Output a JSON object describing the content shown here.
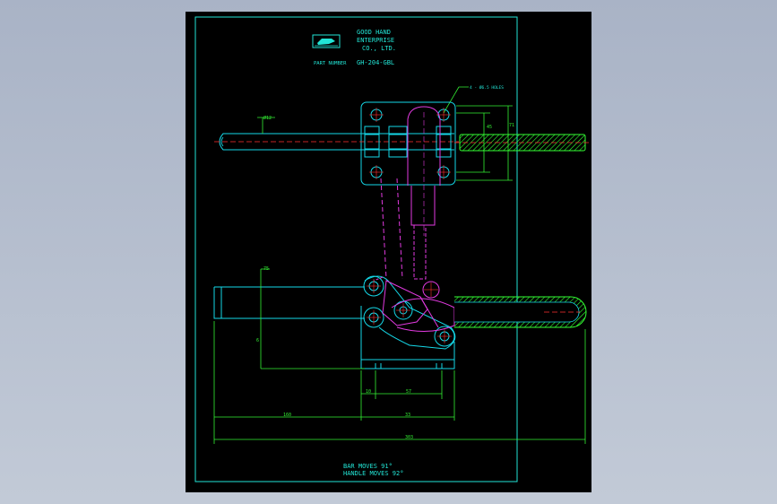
{
  "colors": {
    "background": "#a9b3c6",
    "sheet": "#000000",
    "border": "#22e5d6",
    "outline": "#15d8e8",
    "linkage": "#e23ae0",
    "centerline": "#ff3030",
    "handle_grip": "#33ff33",
    "dimension": "#33f033",
    "text": "#22e5d6"
  },
  "title_block": {
    "logo_icon": "good-hand-logo",
    "company_line1": "GOOD HAND",
    "company_line2": "ENTERPRISE",
    "company_line3": "CO., LTD.",
    "part_number_label": "PART NUMBER",
    "part_number": "GH-204-GBL"
  },
  "annotations": {
    "holes_note": "4 - Ø6.5 HOLES"
  },
  "dimensions": {
    "grip_dia": "Ø12",
    "plate_h1": "45",
    "plate_h2": "71",
    "height_top": "75",
    "height_side": "6",
    "base_a": "10",
    "base_b": "57",
    "bottom_a": "160",
    "bottom_b": "33",
    "overall": "303"
  },
  "footer": {
    "bar_moves": "BAR MOVES 91°",
    "handle_moves": "HANDLE MOVES 92°"
  }
}
